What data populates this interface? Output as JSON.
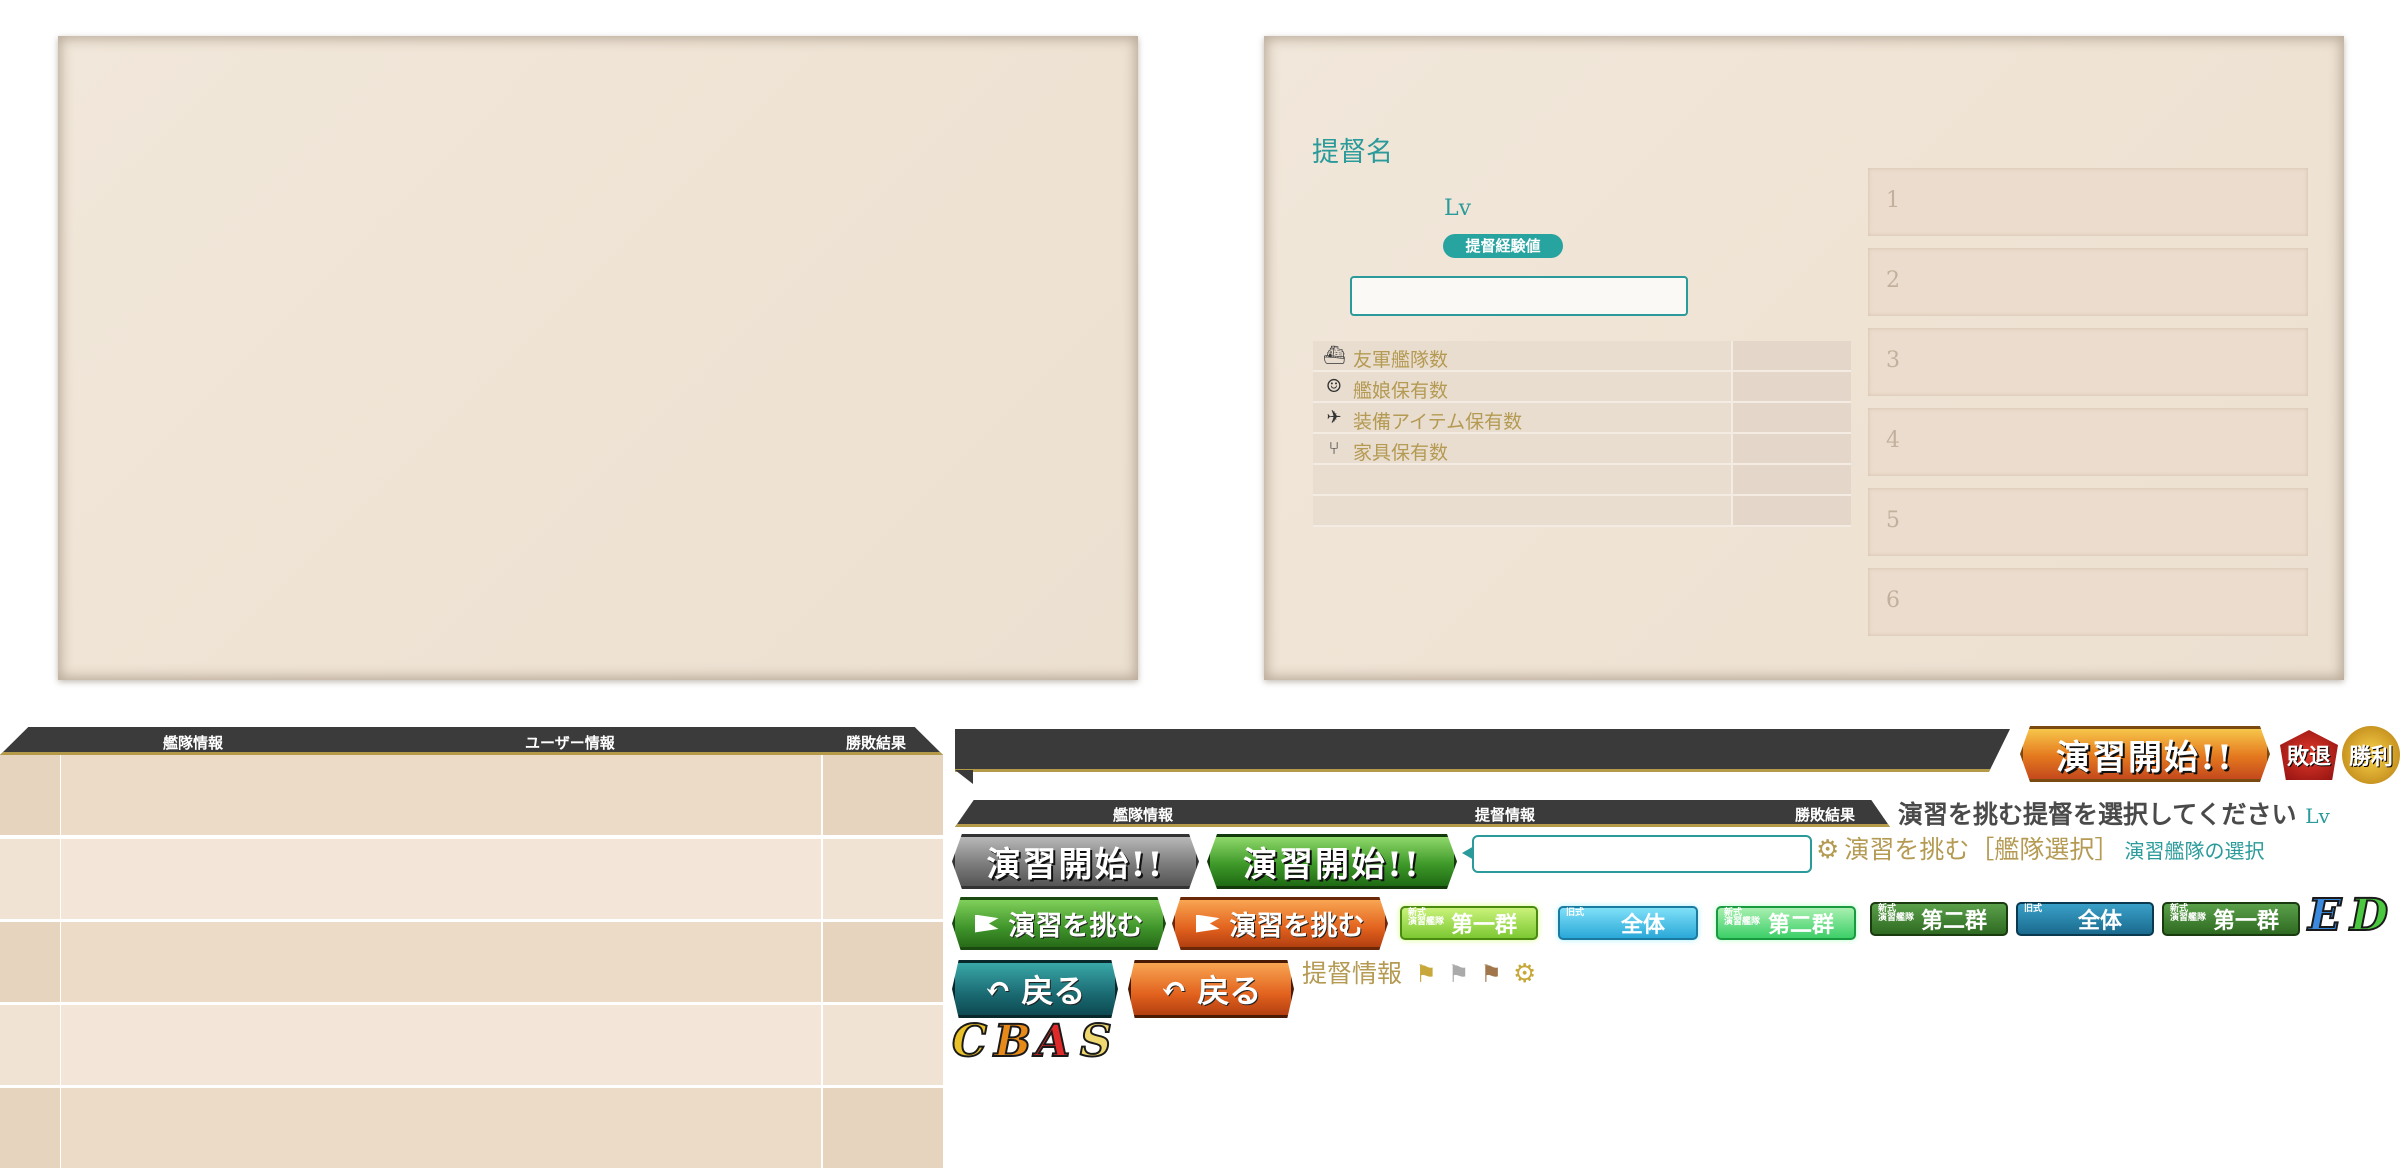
{
  "admiral_panel": {
    "title": "提督名",
    "level_label": "Lv",
    "exp_badge": "提督経験値",
    "comment_value": "",
    "stats": [
      {
        "icon": "fleet-icon",
        "label": "友軍艦隊数",
        "value": ""
      },
      {
        "icon": "shipgirl-icon",
        "label": "艦娘保有数",
        "value": ""
      },
      {
        "icon": "equipment-icon",
        "label": "装備アイテム保有数",
        "value": ""
      },
      {
        "icon": "furniture-icon",
        "label": "家具保有数",
        "value": ""
      },
      {
        "icon": "",
        "label": "",
        "value": ""
      },
      {
        "icon": "",
        "label": "",
        "value": ""
      }
    ],
    "fleet_slots": [
      "1",
      "2",
      "3",
      "4",
      "5",
      "6"
    ]
  },
  "rival_list": {
    "headers": [
      "艦隊情報",
      "ユーザー情報",
      "勝敗結果"
    ],
    "rows": 5
  },
  "small_header": {
    "headers": [
      "艦隊情報",
      "提督情報",
      "勝敗結果"
    ]
  },
  "texts": {
    "select_admiral": "演習を挑む提督を選択してください",
    "select_admiral_lv": "Lv",
    "challenge_fleet": "演習を挑む［艦隊選択］",
    "practice_fleet_select": "演習艦隊の選択",
    "admiral_info": "提督情報"
  },
  "buttons": {
    "start_main": "演習開始!!",
    "start_gray": "演習開始!!",
    "start_green": "演習開始!!",
    "challenge_green": "演習を挑む",
    "challenge_orange": "演習を挑む",
    "back_teal": "戻る",
    "back_orange": "戻る",
    "defeat_badge": "敗退",
    "victory_badge": "勝利"
  },
  "fleet_buttons": [
    {
      "tag": "新式\n演習艦隊",
      "label": "第一群",
      "style": "lime"
    },
    {
      "tag": "旧式",
      "label": "全体",
      "style": "cyan"
    },
    {
      "tag": "新式\n演習艦隊",
      "label": "第二群",
      "style": "mint"
    },
    {
      "tag": "新式\n演習艦隊",
      "label": "第二群",
      "style": "darkgreen"
    },
    {
      "tag": "旧式",
      "label": "全体",
      "style": "darkcyan"
    },
    {
      "tag": "新式\n演習艦隊",
      "label": "第一群",
      "style": "darkgreen"
    }
  ],
  "rank_letters_right": [
    "E",
    "D"
  ],
  "rank_letters_bottom": [
    "C",
    "B",
    "A",
    "S"
  ],
  "colors": {
    "teal": "#2a9a9a",
    "gold": "#b49a52",
    "paper": "#efe3d4",
    "header_bar": "#3b3b3b"
  }
}
